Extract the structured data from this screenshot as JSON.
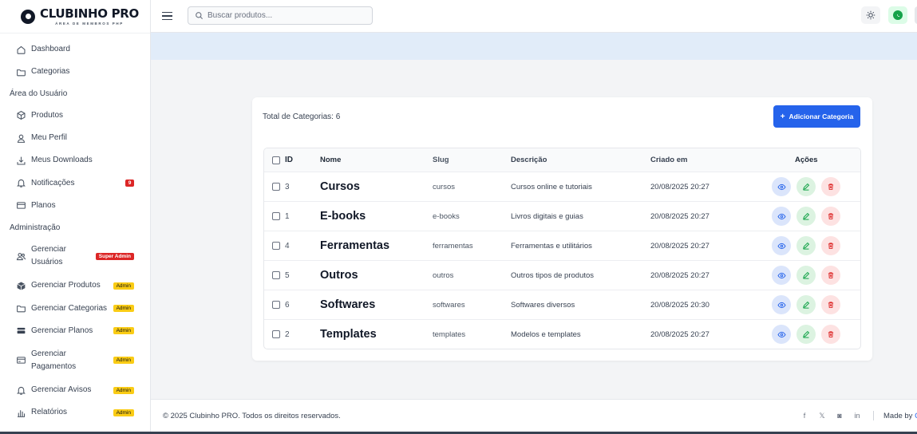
{
  "brand": {
    "title": "CLUBINHO PRO",
    "subtitle": "ÁREA DE MEMBROS PHP"
  },
  "topbar": {
    "search_placeholder": "Buscar produtos..."
  },
  "sidebar": {
    "items_top": [
      {
        "label": "Dashboard",
        "icon": "home-icon"
      },
      {
        "label": "Categorias",
        "icon": "folder-icon"
      }
    ],
    "section_user": "Área do Usuário",
    "items_user": [
      {
        "label": "Produtos",
        "icon": "package-icon"
      },
      {
        "label": "Meu Perfil",
        "icon": "user-icon"
      },
      {
        "label": "Meus Downloads",
        "icon": "download-icon"
      },
      {
        "label": "Notificações",
        "icon": "bell-icon",
        "badge": "9"
      },
      {
        "label": "Planos",
        "icon": "card-icon"
      }
    ],
    "section_admin": "Administração",
    "items_admin": [
      {
        "label_line1": "Gerenciar",
        "label_line2": "Usuários",
        "icon": "users-icon",
        "badge": "Super Admin"
      },
      {
        "label": "Gerenciar Produtos",
        "icon": "box-icon",
        "badge": "Admin"
      },
      {
        "label": "Gerenciar Categorias",
        "icon": "folder-icon",
        "badge": "Admin"
      },
      {
        "label": "Gerenciar Planos",
        "icon": "layers-icon",
        "badge": "Admin"
      },
      {
        "label_line1": "Gerenciar",
        "label_line2": "Pagamentos",
        "icon": "credit-card-icon",
        "badge": "Admin"
      },
      {
        "label": "Gerenciar Avisos",
        "icon": "bell-icon",
        "badge": "Admin"
      },
      {
        "label": "Relatórios",
        "icon": "chart-icon",
        "badge": "Admin"
      }
    ]
  },
  "main": {
    "total_label": "Total de Categorias: 6",
    "add_button": "Adicionar Categoria",
    "columns": {
      "id": "ID",
      "nome": "Nome",
      "slug": "Slug",
      "descricao": "Descrição",
      "criado": "Criado em",
      "acoes": "Ações"
    },
    "rows": [
      {
        "id": "3",
        "nome": "Cursos",
        "slug": "cursos",
        "descricao": "Cursos online e tutoriais",
        "criado": "20/08/2025 20:27"
      },
      {
        "id": "1",
        "nome": "E-books",
        "slug": "e-books",
        "descricao": "Livros digitais e guias",
        "criado": "20/08/2025 20:27"
      },
      {
        "id": "4",
        "nome": "Ferramentas",
        "slug": "ferramentas",
        "descricao": "Ferramentas e utilitários",
        "criado": "20/08/2025 20:27"
      },
      {
        "id": "5",
        "nome": "Outros",
        "slug": "outros",
        "descricao": "Outros tipos de produtos",
        "criado": "20/08/2025 20:27"
      },
      {
        "id": "6",
        "nome": "Softwares",
        "slug": "softwares",
        "descricao": "Softwares diversos",
        "criado": "20/08/2025 20:30"
      },
      {
        "id": "2",
        "nome": "Templates",
        "slug": "templates",
        "descricao": "Modelos e templates",
        "criado": "20/08/2025 20:27"
      }
    ]
  },
  "footer": {
    "copyright": "© 2025 Clubinho PRO. Todos os direitos reservados.",
    "socials": [
      "f",
      "𝕏",
      "◙",
      "in"
    ],
    "made_by_prefix": "Made by ",
    "made_by_link": "C"
  },
  "colors": {
    "primary": "#2563eb",
    "banner": "#e1ecf9",
    "danger": "#dc2626",
    "admin_badge": "#facc15",
    "whatsapp": "#16a34a"
  }
}
